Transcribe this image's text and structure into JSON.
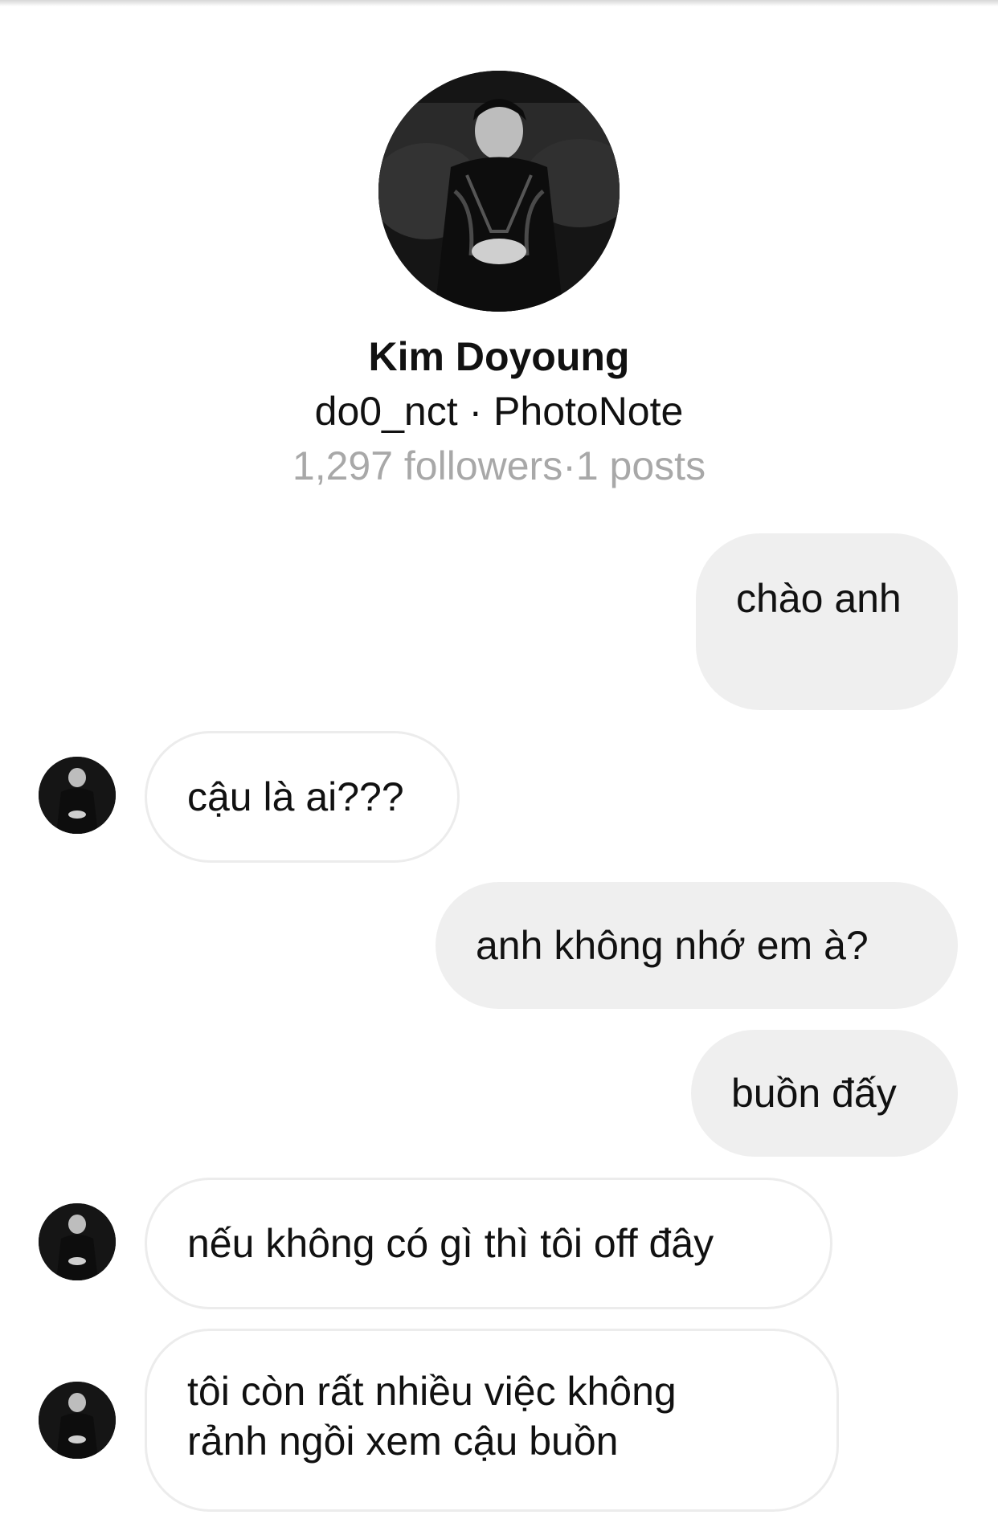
{
  "profile": {
    "name": "Kim Doyoung",
    "handle_line": "do0_nct · PhotoNote",
    "stats_line": "1,297 followers·1 posts",
    "avatar_icon": "profile-photo"
  },
  "messages": [
    {
      "direction": "outgoing",
      "text": "chào anh"
    },
    {
      "direction": "incoming",
      "text": "cậu là ai???"
    },
    {
      "direction": "outgoing",
      "text": "anh không nhớ em à?"
    },
    {
      "direction": "outgoing",
      "text": "buồn đấy"
    },
    {
      "direction": "incoming",
      "text": "nếu không có gì thì tôi off đây"
    },
    {
      "direction": "incoming",
      "lines": [
        "tôi còn rất nhiều việc không",
        "rảnh ngồi xem cậu buồn"
      ]
    }
  ],
  "colors": {
    "outgoing_bubble": "#efefef",
    "incoming_border": "#ececec",
    "muted_text": "#a8a8a8"
  }
}
